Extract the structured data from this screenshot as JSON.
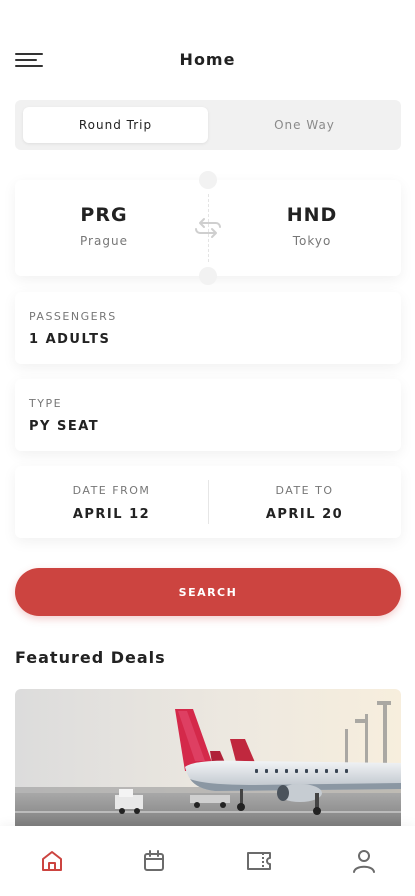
{
  "header": {
    "title": "Home"
  },
  "trip_type": {
    "round_trip": "Round Trip",
    "one_way": "One Way",
    "selected": "Round Trip"
  },
  "route": {
    "from": {
      "code": "PRG",
      "city": "Prague"
    },
    "to": {
      "code": "HND",
      "city": "Tokyo"
    }
  },
  "passengers": {
    "label": "PASSENGERS",
    "value": "1 ADULTS"
  },
  "seat_type": {
    "label": "TYPE",
    "value": "PY SEAT"
  },
  "dates": {
    "from_label": "DATE FROM",
    "from_value": "APRIL 12",
    "to_label": "DATE TO",
    "to_value": "APRIL 20"
  },
  "search": {
    "label": "SEARCH"
  },
  "featured": {
    "title": "Featured Deals"
  },
  "bottom_nav": {
    "items": [
      {
        "icon": "home-icon",
        "active": true
      },
      {
        "icon": "calendar-icon",
        "active": false
      },
      {
        "icon": "ticket-icon",
        "active": false
      },
      {
        "icon": "user-icon",
        "active": false
      }
    ]
  },
  "colors": {
    "accent": "#cc4440",
    "text": "#222222",
    "muted": "#777777",
    "nav_active": "#cc4440",
    "nav_inactive": "#6b6b6b"
  }
}
